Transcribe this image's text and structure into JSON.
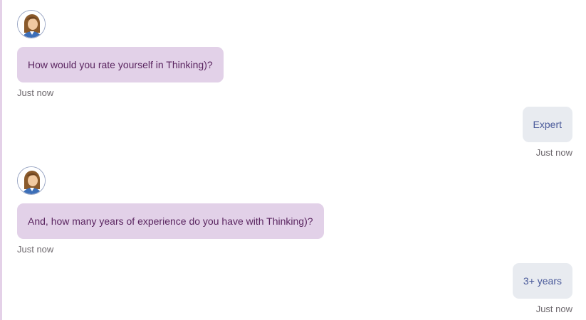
{
  "conversation": {
    "messages": [
      {
        "sender": "bot",
        "avatar_icon": "agent-avatar-icon",
        "text": "How would you rate yourself in Thinking)?",
        "time": "Just now"
      },
      {
        "sender": "user",
        "text": "Expert",
        "time": "Just now"
      },
      {
        "sender": "bot",
        "avatar_icon": "agent-avatar-icon",
        "text": "And, how many years of experience do you have with Thinking)?",
        "time": "Just now"
      },
      {
        "sender": "user",
        "text": "3+ years",
        "time": "Just now"
      }
    ]
  },
  "colors": {
    "bot_bubble": "#e2d1e8",
    "bot_text": "#5a2560",
    "user_bubble": "#e8ebf0",
    "user_text": "#4a5a9a",
    "accent_border": "#e4d1e8"
  }
}
